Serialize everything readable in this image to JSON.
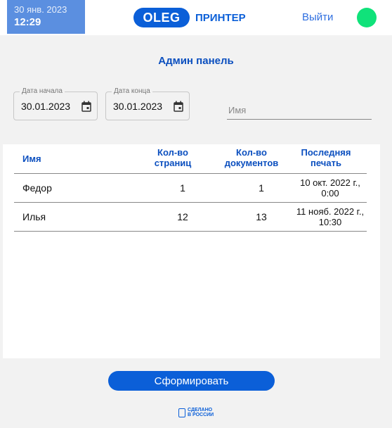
{
  "header": {
    "date": "30 янв. 2023",
    "time": "12:29",
    "logo_mark": "OLEG",
    "logo_text": "ПРИНТЕР",
    "logout_label": "Выйти",
    "status_color": "#10e27a"
  },
  "page_title": "Админ панель",
  "filters": {
    "start_date_label": "Дата начала",
    "start_date_value": "30.01.2023",
    "end_date_label": "Дата конца",
    "end_date_value": "30.01.2023",
    "name_placeholder": "Имя"
  },
  "table": {
    "columns": [
      "Имя",
      "Кол-во страниц",
      "Кол-во документов",
      "Последняя печать"
    ],
    "rows": [
      {
        "name": "Федор",
        "pages": "1",
        "documents": "1",
        "last_print": "10 окт. 2022 г., 0:00"
      },
      {
        "name": "Илья",
        "pages": "12",
        "documents": "13",
        "last_print": "11 нояб. 2022 г., 10:30"
      }
    ]
  },
  "generate_label": "Сформировать",
  "footer": {
    "made_in": "СДЕЛАНО В РОССИИ"
  },
  "colors": {
    "accent": "#0b5fd8",
    "clock_bg": "#5b8fe0"
  }
}
